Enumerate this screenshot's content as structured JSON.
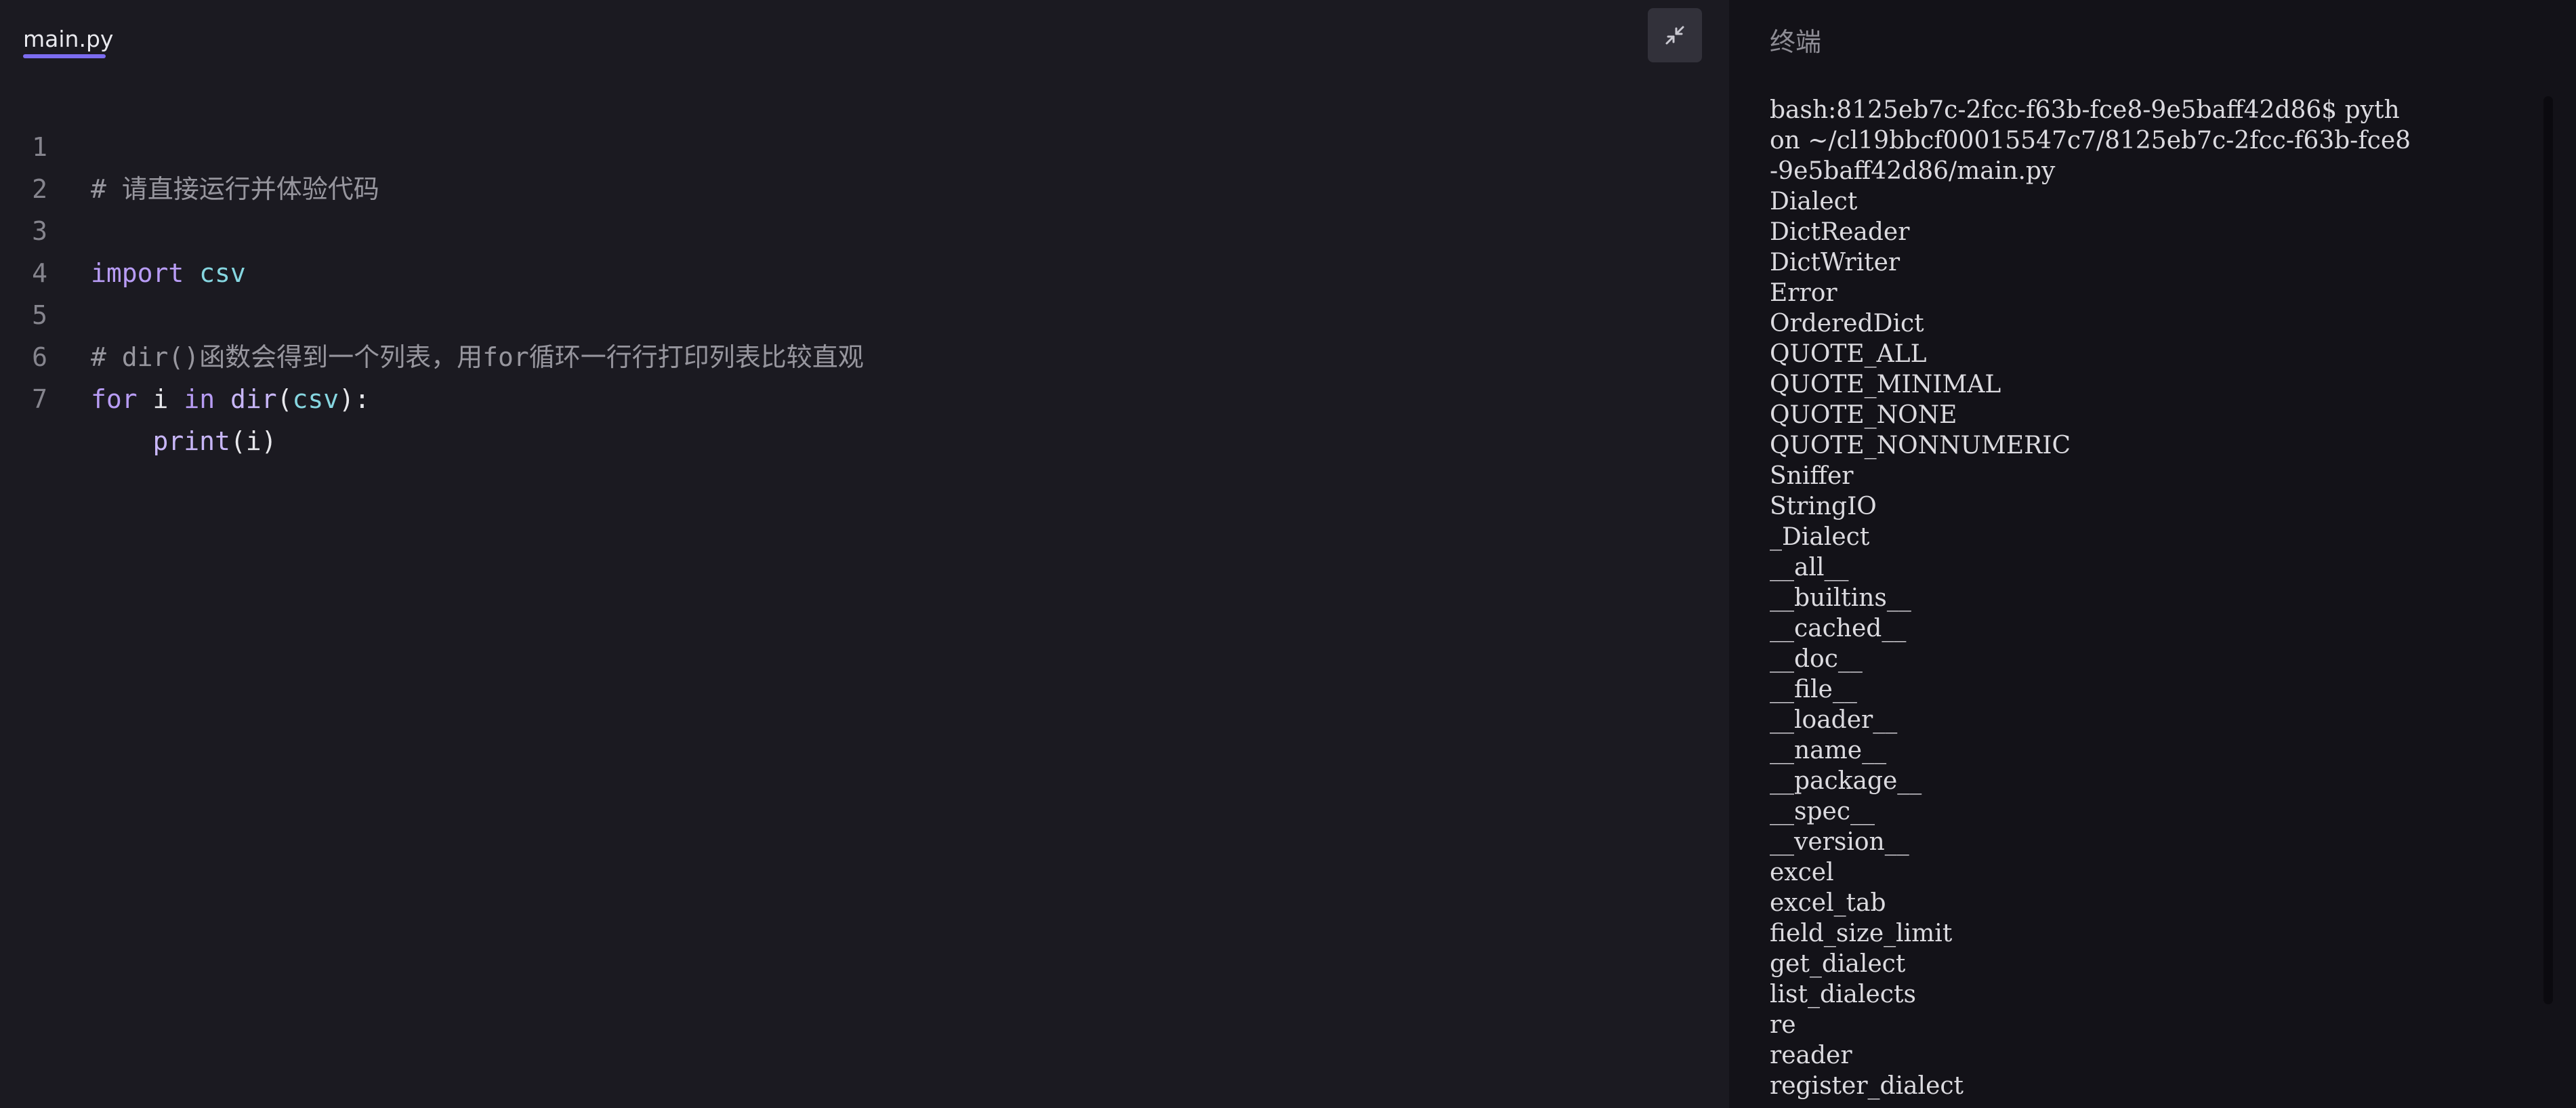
{
  "editor": {
    "tab_label": "main.py",
    "collapse_icon": "collapse-arrows-icon",
    "lines": [
      {
        "num": "1"
      },
      {
        "num": "2"
      },
      {
        "num": "3"
      },
      {
        "num": "4"
      },
      {
        "num": "5"
      },
      {
        "num": "6"
      },
      {
        "num": "7"
      }
    ],
    "code": {
      "l1_comment": "# 请直接运行并体验代码",
      "l3_kw": "import",
      "l3_mod": "csv",
      "l5_comment": "# dir()函数会得到一个列表，用for循环一行行打印列表比较直观",
      "l6_for": "for",
      "l6_i": "i",
      "l6_in": "in",
      "l6_dir": "dir",
      "l6_open": "(",
      "l6_csv": "csv",
      "l6_close": "):",
      "l7_indent": "    ",
      "l7_print": "print",
      "l7_args": "(i)"
    }
  },
  "terminal": {
    "title": "终端",
    "lines": [
      "bash:8125eb7c-2fcc-f63b-fce8-9e5baff42d86$ pyth",
      "on ~/cl19bbcf00015547c7/8125eb7c-2fcc-f63b-fce8",
      "-9e5baff42d86/main.py",
      "Dialect",
      "DictReader",
      "DictWriter",
      "Error",
      "OrderedDict",
      "QUOTE_ALL",
      "QUOTE_MINIMAL",
      "QUOTE_NONE",
      "QUOTE_NONNUMERIC",
      "Sniffer",
      "StringIO",
      "_Dialect",
      "__all__",
      "__builtins__",
      "__cached__",
      "__doc__",
      "__file__",
      "__loader__",
      "__name__",
      "__package__",
      "__spec__",
      "__version__",
      "excel",
      "excel_tab",
      "field_size_limit",
      "get_dialect",
      "list_dialects",
      "re",
      "reader",
      "register_dialect"
    ]
  },
  "colors": {
    "editor_bg": "#1b1a21",
    "terminal_bg": "#131218",
    "accent": "#7c6cf0",
    "keyword": "#b89cf5",
    "module": "#86d6e0",
    "comment": "#97969e"
  }
}
